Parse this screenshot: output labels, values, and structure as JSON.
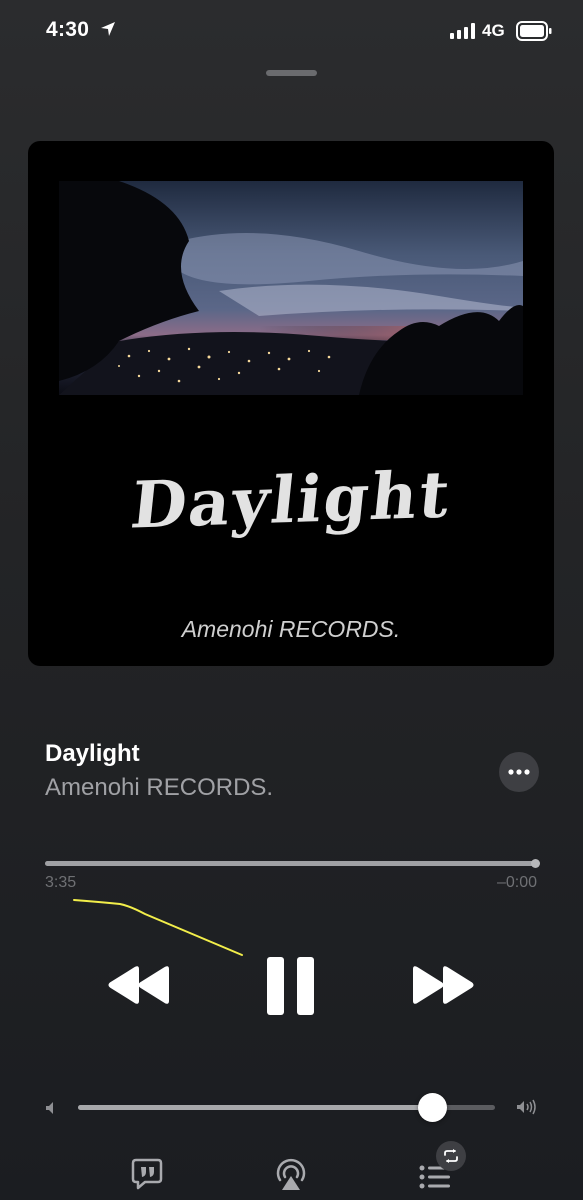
{
  "status_bar": {
    "time": "4:30",
    "network": "4G"
  },
  "artwork": {
    "title_text": "Daylight",
    "label_text": "Amenohi RECORDS."
  },
  "track": {
    "title": "Daylight",
    "artist": "Amenohi RECORDS."
  },
  "playback": {
    "elapsed": "3:35",
    "remaining": "–0:00",
    "progress": 1.0,
    "state": "playing"
  },
  "volume": {
    "level": 0.85
  },
  "icons": {
    "location": "location-arrow-icon",
    "signal": "cellular-signal-icon",
    "battery": "battery-icon",
    "more": "ellipsis-icon",
    "rewind": "rewind-icon",
    "pause": "pause-icon",
    "forward": "fast-forward-icon",
    "volume_min": "speaker-low-icon",
    "volume_max": "speaker-high-icon",
    "lyrics": "lyrics-quote-icon",
    "airplay": "airplay-icon",
    "queue": "queue-list-icon",
    "repeat": "repeat-icon"
  },
  "colors": {
    "accent_annotation": "#f2ee4a",
    "secondary_text": "#a0a1a5"
  }
}
